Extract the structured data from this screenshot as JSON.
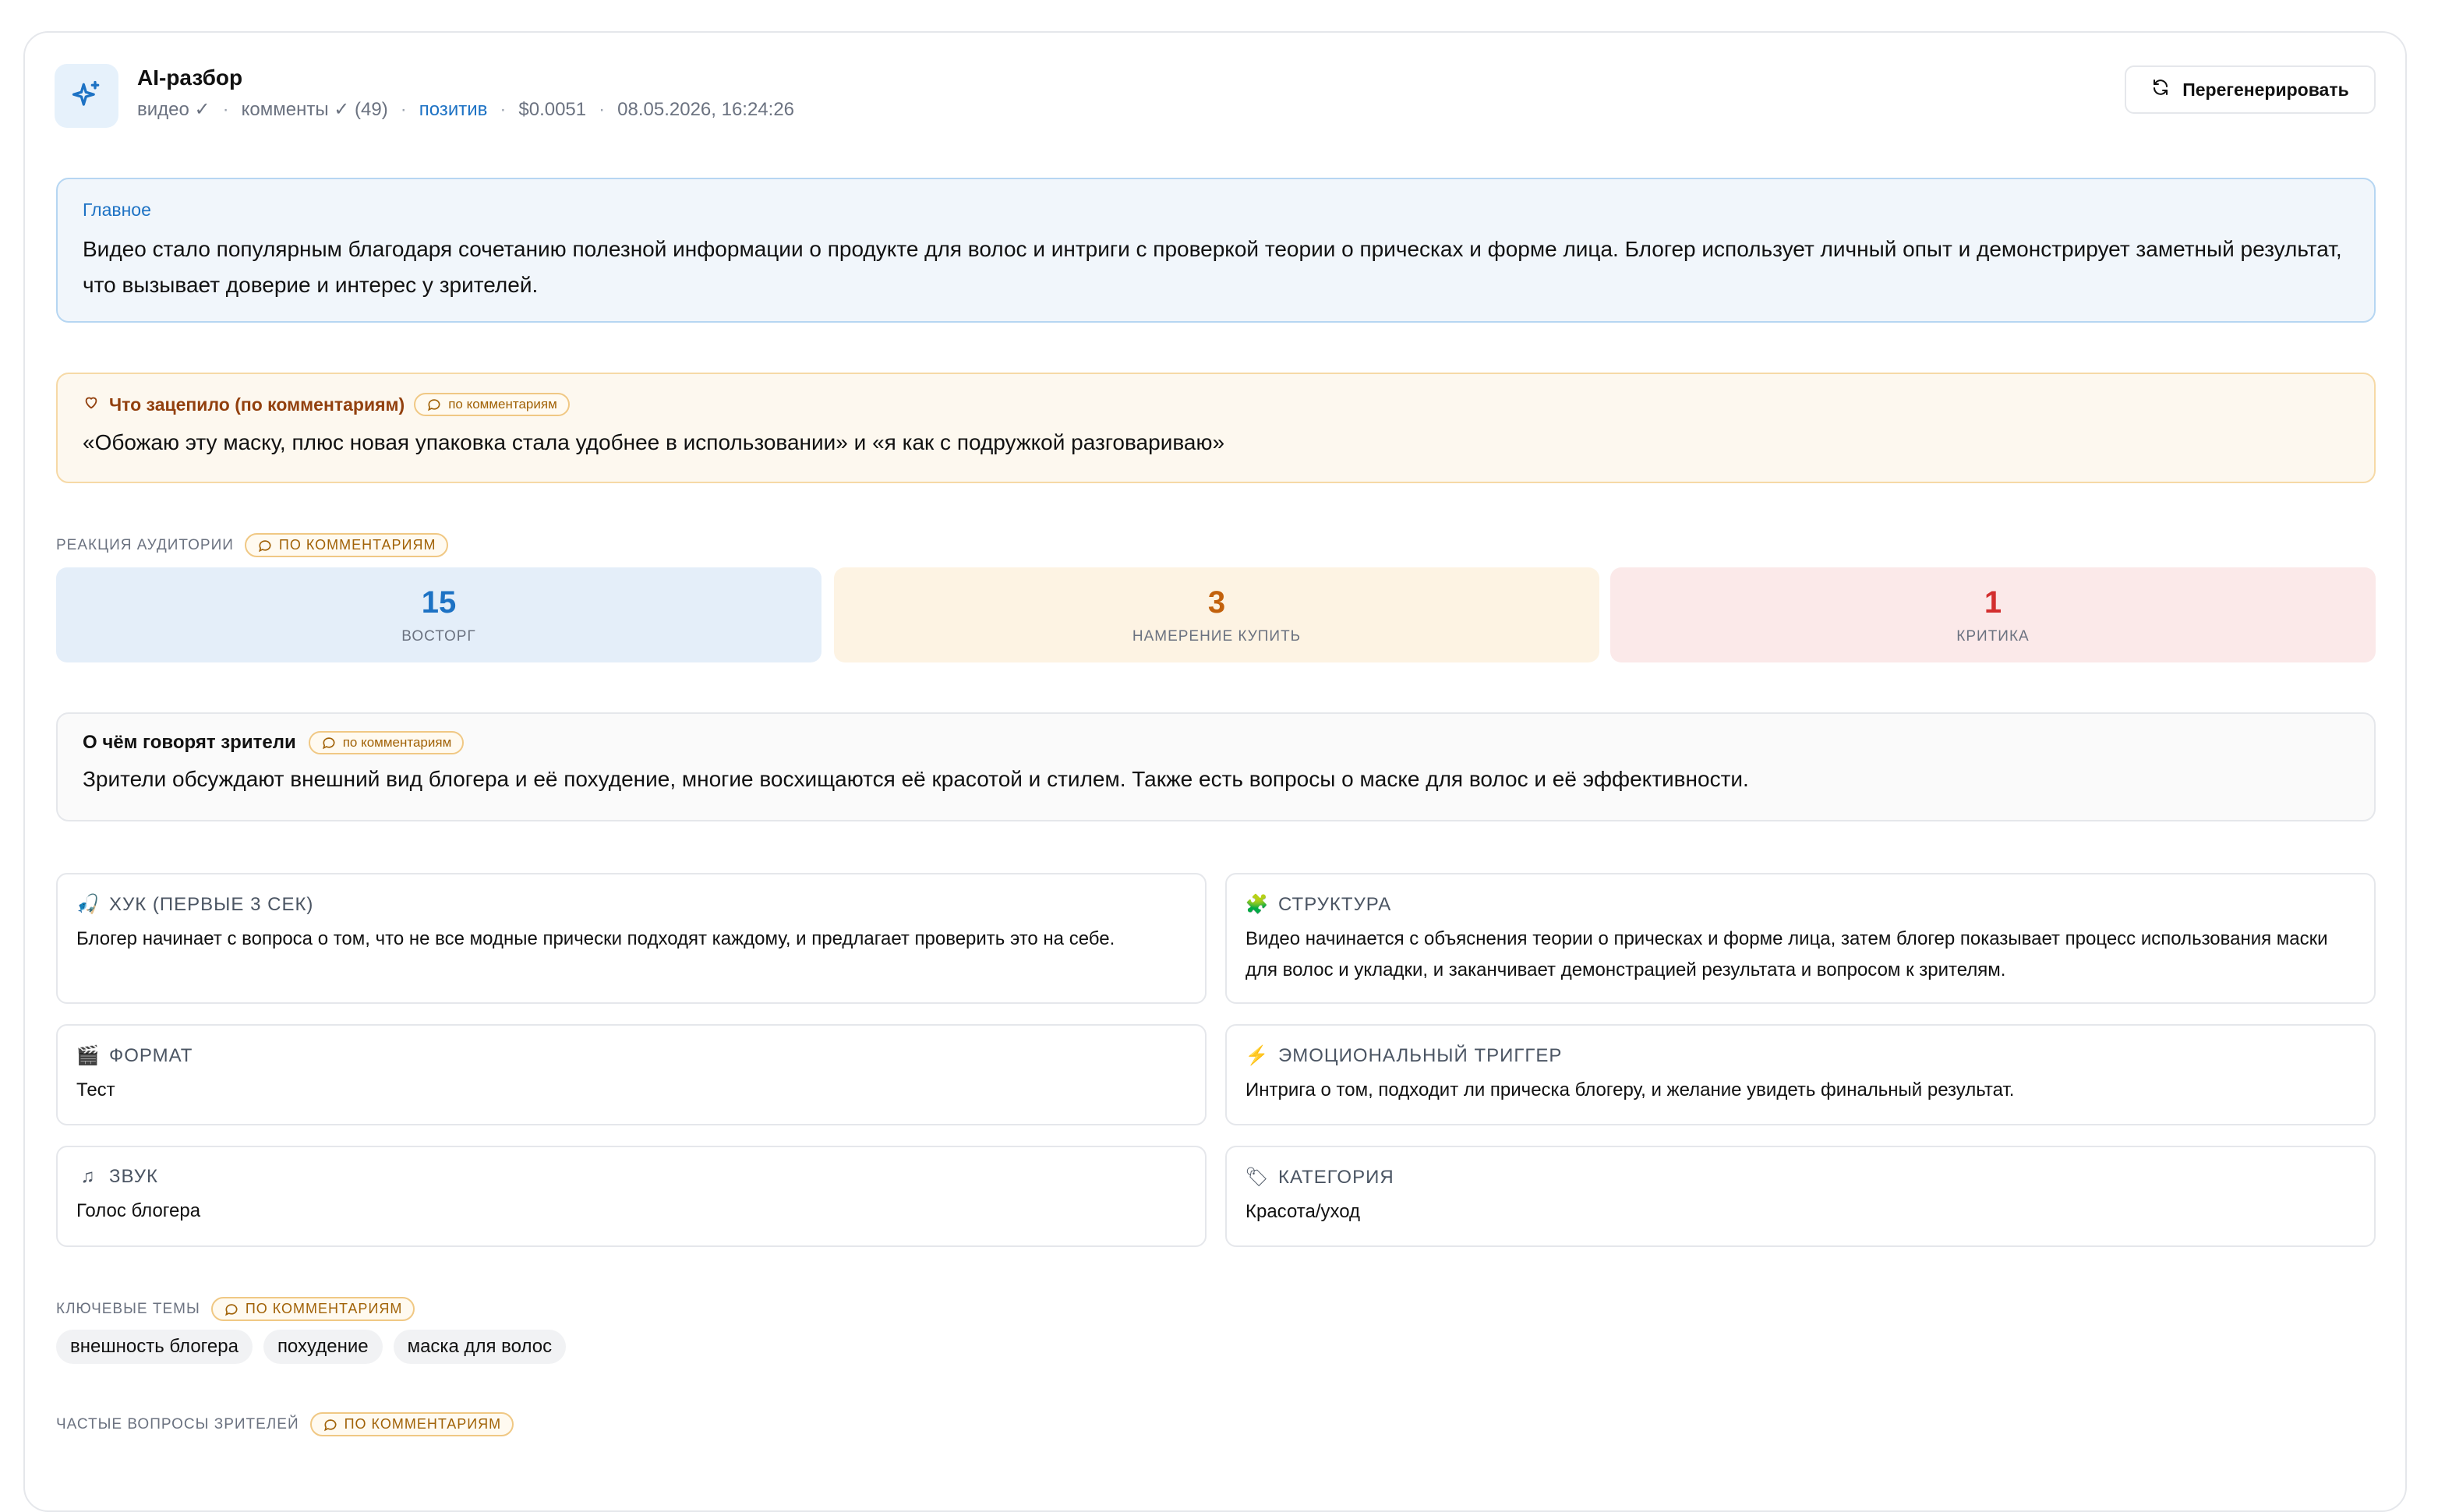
{
  "header": {
    "title": "AI-разбор",
    "meta": {
      "video": "видео ✓",
      "comments": "комменты ✓ (49)",
      "sentiment": "позитив",
      "cost": "$0.0051",
      "datetime": "08.05.2026, 16:24:26",
      "separator": "·"
    },
    "regenerate_label": "Перегенерировать"
  },
  "main": {
    "label": "Главное",
    "text": "Видео стало популярным благодаря сочетанию полезной информации о продукте для волос и интриги с проверкой теории о прическах и форме лица. Блогер использует личный опыт и демонстрирует заметный результат, что вызывает доверие и интерес у зрителей."
  },
  "hook": {
    "label": "Что зацепило (по комментариям)",
    "badge": "по комментариям",
    "text": "«Обожаю эту маску, плюс новая упаковка стала удобнее в использовании» и «я как с подружкой разговариваю»"
  },
  "reaction": {
    "label": "РЕАКЦИЯ АУДИТОРИИ",
    "badge": "ПО КОММЕНТАРИЯМ",
    "stats": [
      {
        "value": "15",
        "label": "ВОСТОРГ",
        "color": "#1d72c4"
      },
      {
        "value": "3",
        "label": "НАМЕРЕНИЕ КУПИТЬ",
        "color": "#c2610c"
      },
      {
        "value": "1",
        "label": "КРИТИКА",
        "color": "#d32f2f"
      }
    ]
  },
  "talk": {
    "label": "О чём говорят зрители",
    "badge": "по комментариям",
    "text": "Зрители обсуждают внешний вид блогера и её похудение, многие восхищаются её красотой и стилем. Также есть вопросы о маске для волос и её эффективности."
  },
  "tiles": [
    {
      "icon": "🎣",
      "icon_name": "fishing-icon",
      "label": "ХУК (ПЕРВЫЕ 3 СЕК)",
      "text": "Блогер начинает с вопроса о том, что не все модные прически подходят каждому, и предлагает проверить это на себе."
    },
    {
      "icon": "🧩",
      "icon_name": "puzzle-icon",
      "label": "СТРУКТУРА",
      "text": "Видео начинается с объяснения теории о прическах и форме лица, затем блогер показывает процесс использования маски для волос и укладки, и заканчивает демонстрацией результата и вопросом к зрителям."
    },
    {
      "icon": "🎬",
      "icon_name": "clapper-icon",
      "label": "ФОРМАТ",
      "text": "Тест"
    },
    {
      "icon": "⚡",
      "icon_name": "lightning-icon",
      "label": "ЭМОЦИОНАЛЬНЫЙ ТРИГГЕР",
      "text": "Интрига о том, подходит ли прическа блогеру, и желание увидеть финальный результат."
    },
    {
      "icon": "♫",
      "icon_name": "music-icon",
      "label": "ЗВУК",
      "text": "Голос блогера"
    },
    {
      "icon": "🏷",
      "icon_name": "tag-icon",
      "label": "КАТЕГОРИЯ",
      "text": "Красота/уход"
    }
  ],
  "topics": {
    "label": "КЛЮЧЕВЫЕ ТЕМЫ",
    "badge": "ПО КОММЕНТАРИЯМ",
    "items": [
      "внешность блогера",
      "похудение",
      "маска для волос"
    ]
  },
  "questions": {
    "label": "ЧАСТЫЕ ВОПРОСЫ ЗРИТЕЛЕЙ",
    "badge": "ПО КОММЕНТАРИЯМ"
  }
}
